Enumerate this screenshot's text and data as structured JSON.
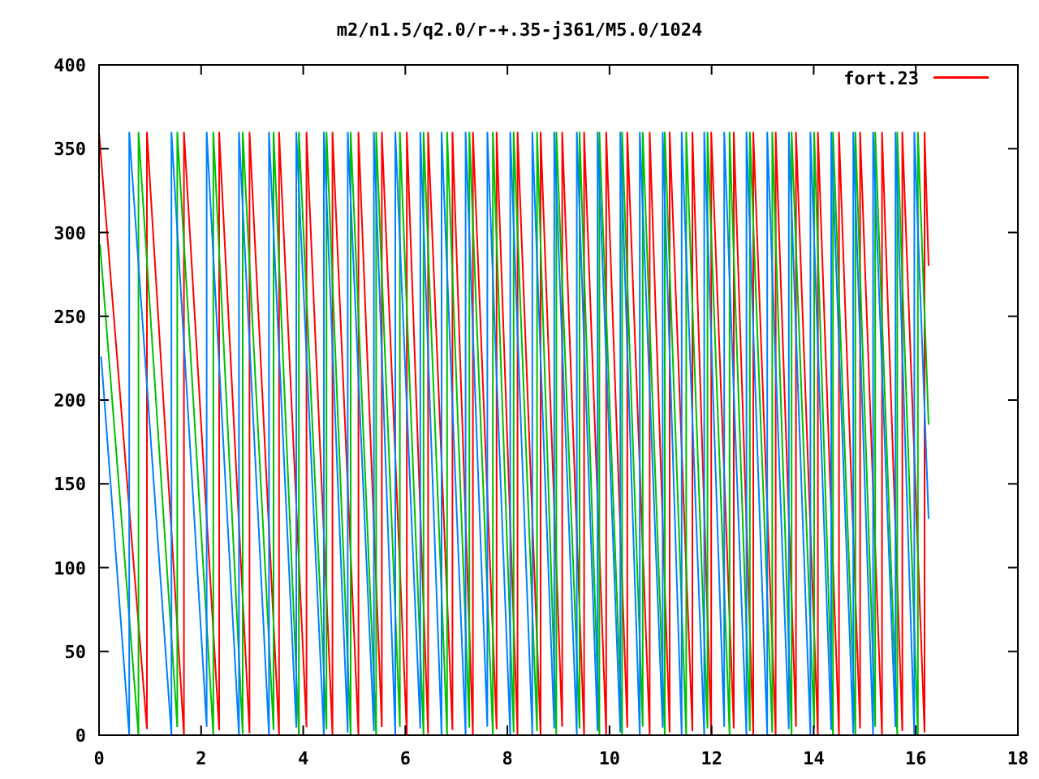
{
  "title": "m2/n1.5/q2.0/r-+.35-j361/M5.0/1024",
  "y_ticks": [
    "400",
    "350",
    "300",
    "250",
    "200",
    "150",
    "100",
    "50",
    "0"
  ],
  "x_ticks": [
    "0",
    "2",
    "4",
    "6",
    "8",
    "10",
    "12",
    "14",
    "16",
    "18"
  ],
  "legend": {
    "label": "fort.23",
    "color": "#ff0000"
  }
}
